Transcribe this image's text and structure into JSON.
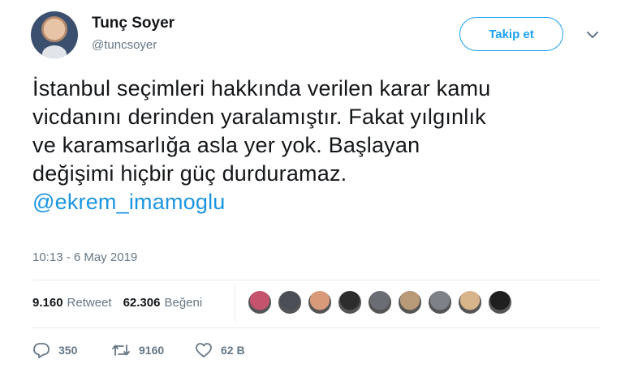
{
  "author": {
    "name": "Tunç Soyer",
    "handle": "@tuncsoyer"
  },
  "follow_button": {
    "label": "Takip et"
  },
  "menu": {
    "icon": "chevron-down-icon"
  },
  "tweet": {
    "lines": [
      "İstanbul seçimleri hakkında verilen karar kamu",
      "vicdanını derinden yaralamıştır. Fakat yılgınlık",
      "ve karamsarlığa asla yer yok. Başlayan",
      "değişimi hiçbir güç durduramaz."
    ],
    "mention": "@ekrem_imamoglu",
    "timestamp": "10:13 - 6 May 2019"
  },
  "stats": {
    "retweets": {
      "count": "9.160",
      "label": "Retweet"
    },
    "likes": {
      "count": "62.306",
      "label": "Beğeni"
    }
  },
  "likers": [
    {
      "color": "#c6536e"
    },
    {
      "color": "#4a4f57"
    },
    {
      "color": "#d99a7a"
    },
    {
      "color": "#2d2d2d"
    },
    {
      "color": "#6a6d73"
    },
    {
      "color": "#b89a78"
    },
    {
      "color": "#7d8288"
    },
    {
      "color": "#d8b48a"
    },
    {
      "color": "#1f1f1f"
    }
  ],
  "actions": {
    "reply": {
      "icon": "reply-icon",
      "count": "350"
    },
    "retweet": {
      "icon": "retweet-icon",
      "count": "9160"
    },
    "like": {
      "icon": "heart-icon",
      "count": "62 B"
    }
  },
  "colors": {
    "accent": "#1da1f2",
    "mention": "#1b95e0",
    "muted": "#657786",
    "text": "#14171a"
  }
}
